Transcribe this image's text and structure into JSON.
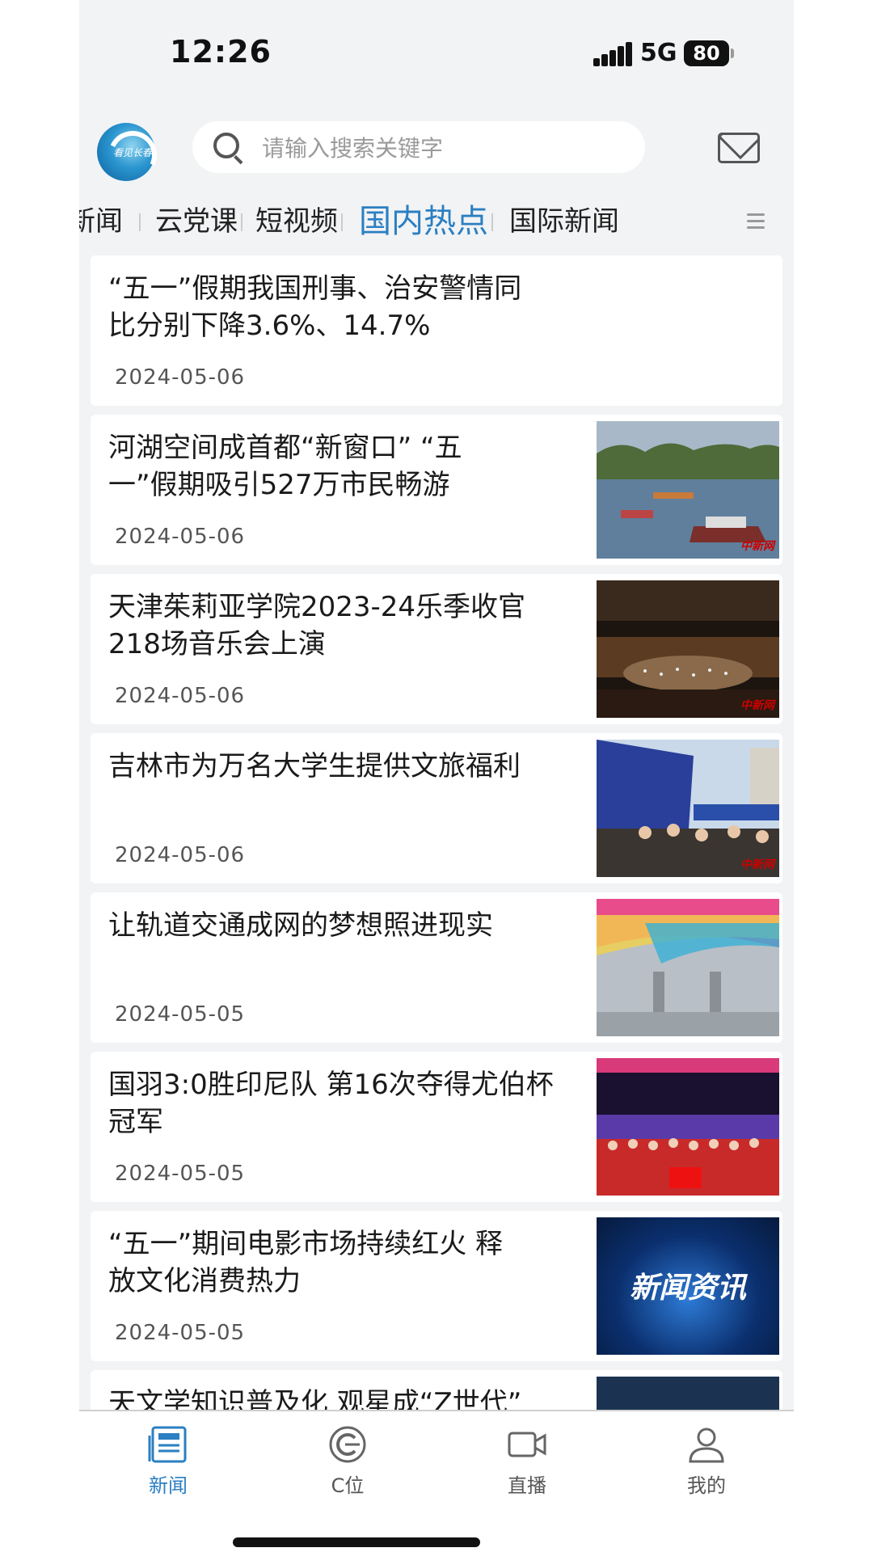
{
  "status_bar": {
    "time": "12:26",
    "network": "5G",
    "battery": "80"
  },
  "header": {
    "logo_text": "看见长春",
    "search_placeholder": "请输入搜索关键字"
  },
  "tabs": [
    {
      "label": "新闻",
      "active": false
    },
    {
      "label": "云党课",
      "active": false
    },
    {
      "label": "短视频",
      "active": false
    },
    {
      "label": "国内热点",
      "active": true
    },
    {
      "label": "国际新闻",
      "active": false
    }
  ],
  "articles": [
    {
      "title_lines": [
        "“五一”假期我国刑事、治安警情同",
        "比分别下降3.6%、14.7%"
      ],
      "date": "2024-05-06",
      "thumbnail": "none"
    },
    {
      "title_lines": [
        "河湖空间成首都“新窗口” “五",
        "一”假期吸引527万市民畅游"
      ],
      "date": "2024-05-06",
      "thumbnail": "lake-boats-photo"
    },
    {
      "title_lines": [
        "天津茱莉亚学院2023-24乐季收官",
        "218场音乐会上演"
      ],
      "date": "2024-05-06",
      "thumbnail": "concert-hall-photo"
    },
    {
      "title_lines": [
        "吉林市为万名大学生提供文旅福利"
      ],
      "date": "2024-05-06",
      "thumbnail": "crowd-event-photo"
    },
    {
      "title_lines": [
        "让轨道交通成网的梦想照进现实"
      ],
      "date": "2024-05-05",
      "thumbnail": "metro-station-photo"
    },
    {
      "title_lines": [
        "国羽3:0胜印尼队 第16次夺得尤伯杯",
        "冠军"
      ],
      "date": "2024-05-05",
      "thumbnail": "team-photo"
    },
    {
      "title_lines": [
        "“五一”期间电影市场持续红火 释",
        "放文化消费热力"
      ],
      "date": "2024-05-05",
      "thumbnail": "news-brand-graphic",
      "thumbnail_text": "新闻资讯"
    },
    {
      "title_lines": [
        "天文学知识普及化 观星成“Z世代”"
      ],
      "date": "",
      "thumbnail": "starry-sky-photo"
    }
  ],
  "bottom_nav": [
    {
      "label": "新闻",
      "icon": "newspaper-icon",
      "active": true
    },
    {
      "label": "C位",
      "icon": "c-position-icon",
      "active": false
    },
    {
      "label": "直播",
      "icon": "video-camera-icon",
      "active": false
    },
    {
      "label": "我的",
      "icon": "person-icon",
      "active": false
    }
  ],
  "colors": {
    "accent": "#2b7fc2",
    "background": "#f2f3f5",
    "card": "#ffffff"
  }
}
